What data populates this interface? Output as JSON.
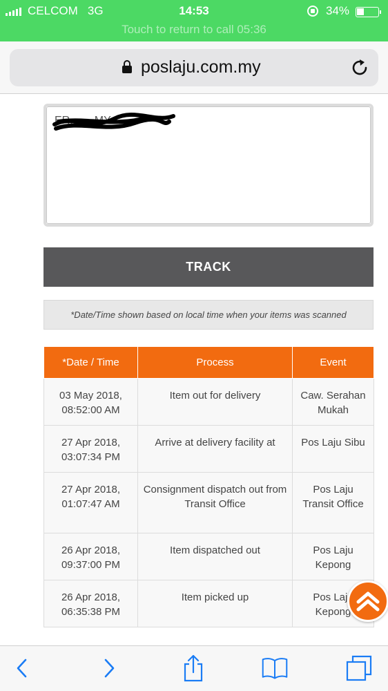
{
  "status_bar": {
    "carrier": "CELCOM",
    "network": "3G",
    "time": "14:53",
    "battery": "34%",
    "call_banner": "Touch to return to call 05:36"
  },
  "browser": {
    "url": "poslaju.com.my",
    "lock_icon": "lock-icon",
    "reload_icon": "reload-icon"
  },
  "form": {
    "tracking_value": "ER........MY",
    "track_label": "TRACK",
    "note": "*Date/Time shown based on local time when your items was scanned"
  },
  "table": {
    "headers": [
      "*Date / Time",
      "Process",
      "Event"
    ],
    "rows": [
      {
        "date": "03 May 2018,",
        "time": "08:52:00 AM",
        "process": "Item out for delivery",
        "event": "Caw. Serahan Mukah"
      },
      {
        "date": "27 Apr 2018,",
        "time": "03:07:34 PM",
        "process": "Arrive at delivery facility at",
        "event": "Pos Laju Sibu"
      },
      {
        "date": "27 Apr 2018,",
        "time": "01:07:47 AM",
        "process": "Consignment dispatch out from Transit Office",
        "event": "Pos Laju Transit Office"
      },
      {
        "date": "26 Apr 2018,",
        "time": "09:37:00 PM",
        "process": "Item dispatched out",
        "event": "Pos Laju Kepong"
      },
      {
        "date": "26 Apr 2018,",
        "time": "06:35:38 PM",
        "process": "Item picked up",
        "event": "Pos Laju Kepong"
      }
    ]
  },
  "colors": {
    "status_green": "#4cd964",
    "accent_orange": "#f26b10",
    "button_gray": "#58585a",
    "ios_blue": "#1a7cf5"
  }
}
